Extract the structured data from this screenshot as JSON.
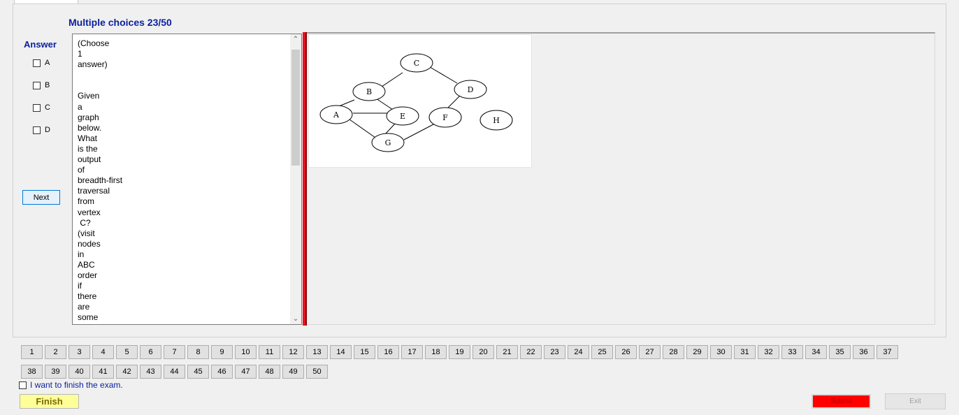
{
  "header": {
    "title": "Multiple choices 23/50"
  },
  "answer": {
    "label": "Answer",
    "options": [
      "A",
      "B",
      "C",
      "D"
    ]
  },
  "next_button": "Next",
  "question": {
    "text": "(Choose\n1\nanswer)\n\n\nGiven\na\ngraph\nbelow.\nWhat\nis the\noutput\nof\nbreadth-first\ntraversal\nfrom\nvertex\n C?\n(visit\nnodes\nin\nABC\norder\nif\nthere\nare\nsome"
  },
  "graph_image": {
    "nodes": [
      "A",
      "B",
      "C",
      "D",
      "E",
      "F",
      "G",
      "H"
    ]
  },
  "navigation": {
    "row1": [
      "1",
      "2",
      "3",
      "4",
      "5",
      "6",
      "7",
      "8",
      "9",
      "10",
      "11",
      "12",
      "13",
      "14",
      "15",
      "16",
      "17",
      "18",
      "19",
      "20",
      "21",
      "22",
      "23",
      "24",
      "25",
      "26",
      "27",
      "28",
      "29",
      "30",
      "31",
      "32",
      "33",
      "34",
      "35",
      "36",
      "37"
    ],
    "row2": [
      "38",
      "39",
      "40",
      "41",
      "42",
      "43",
      "44",
      "45",
      "46",
      "47",
      "48",
      "49",
      "50"
    ]
  },
  "footer": {
    "finish_checkbox_label": "I want to finish the exam.",
    "finish_button": "Finish",
    "submit_button": "Submit",
    "exit_button": "Exit"
  },
  "colors": {
    "accent": "#0a1f9e",
    "divider": "#e81123",
    "finish_bg": "#ffff99",
    "submit_bg": "#ff0000"
  }
}
